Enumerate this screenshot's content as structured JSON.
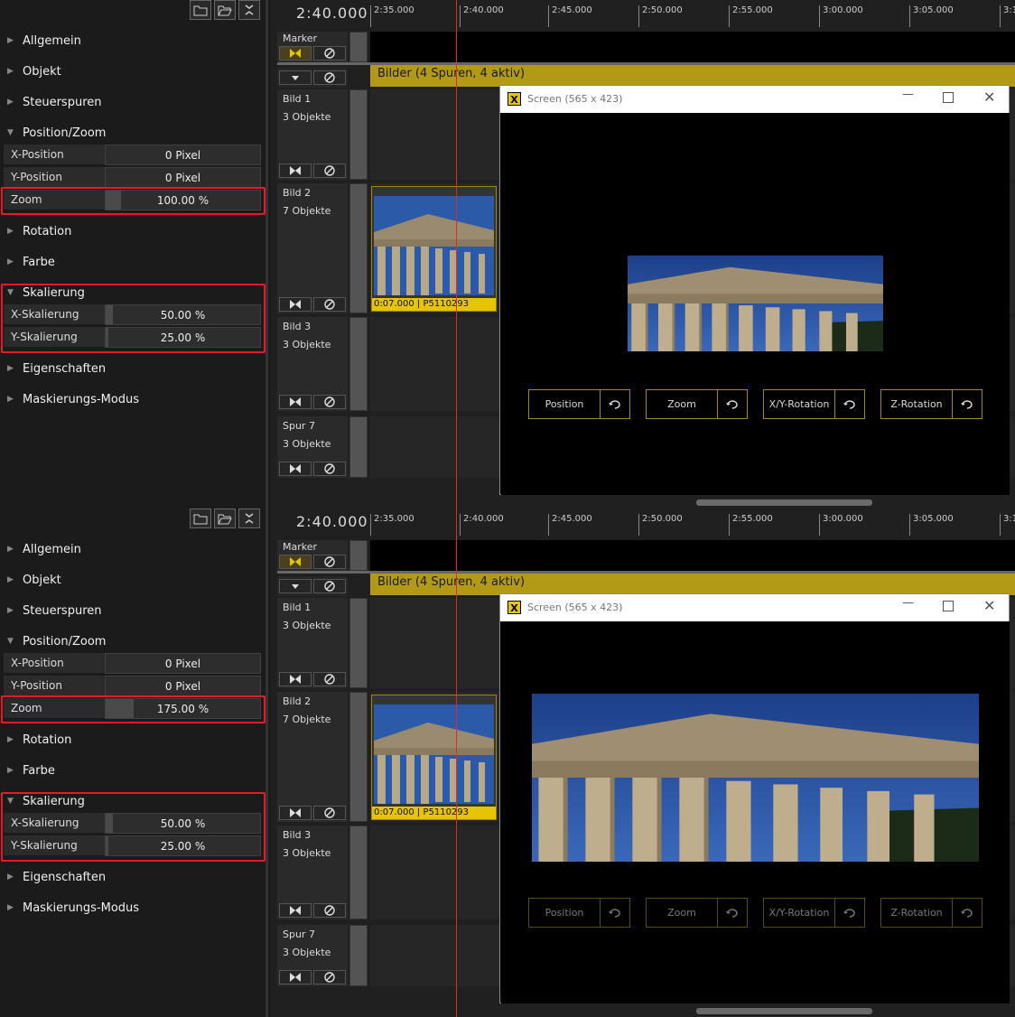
{
  "panels": [
    {
      "sections": {
        "allgemein": "Allgemein",
        "objekt": "Objekt",
        "steuerspuren": "Steuerspuren",
        "position_zoom": "Position/Zoom",
        "rotation": "Rotation",
        "farbe": "Farbe",
        "skalierung": "Skalierung",
        "eigenschaften": "Eigenschaften",
        "maskierung": "Maskierungs-Modus"
      },
      "props": {
        "x_pos_label": "X-Position",
        "x_pos_value": "0 Pixel",
        "y_pos_label": "Y-Position",
        "y_pos_value": "0 Pixel",
        "zoom_label": "Zoom",
        "zoom_value": "100.00 %",
        "zoom_level": 0.1,
        "xs_label": "X-Skalierung",
        "xs_value": "50.00 %",
        "ys_label": "Y-Skalierung",
        "ys_value": "25.00 %"
      },
      "timeline": {
        "time": "2:40.000",
        "ticks": [
          "2:35.000",
          "2:40.000",
          "2:45.000",
          "2:50.000",
          "2:55.000",
          "3:00.000",
          "3:05.000",
          "3:1"
        ],
        "marker": "Marker",
        "group": "Bilder  (4 Spuren, 4 aktiv)",
        "tracks": [
          {
            "name": "Bild 1",
            "objs": "3 Objekte"
          },
          {
            "name": "Bild 2",
            "objs": "7 Objekte"
          },
          {
            "name": "Bild 3",
            "objs": "3 Objekte"
          },
          {
            "name": "Spur 7",
            "objs": "3 Objekte"
          }
        ],
        "clip": "0:07.000  |  P5110293"
      },
      "window": {
        "title": "Screen (565 x 423)",
        "buttons": [
          "Position",
          "Zoom",
          "X/Y-Rotation",
          "Z-Rotation"
        ]
      }
    },
    {
      "sections": {
        "allgemein": "Allgemein",
        "objekt": "Objekt",
        "steuerspuren": "Steuerspuren",
        "position_zoom": "Position/Zoom",
        "rotation": "Rotation",
        "farbe": "Farbe",
        "skalierung": "Skalierung",
        "eigenschaften": "Eigenschaften",
        "maskierung": "Maskierungs-Modus"
      },
      "props": {
        "x_pos_label": "X-Position",
        "x_pos_value": "0 Pixel",
        "y_pos_label": "Y-Position",
        "y_pos_value": "0 Pixel",
        "zoom_label": "Zoom",
        "zoom_value": "175.00 %",
        "zoom_level": 0.18,
        "xs_label": "X-Skalierung",
        "xs_value": "50.00 %",
        "ys_label": "Y-Skalierung",
        "ys_value": "25.00 %"
      },
      "timeline": {
        "time": "2:40.000",
        "ticks": [
          "2:35.000",
          "2:40.000",
          "2:45.000",
          "2:50.000",
          "2:55.000",
          "3:00.000",
          "3:05.000",
          "3:1"
        ],
        "marker": "Marker",
        "group": "Bilder  (4 Spuren, 4 aktiv)",
        "tracks": [
          {
            "name": "Bild 1",
            "objs": "3 Objekte"
          },
          {
            "name": "Bild 2",
            "objs": "7 Objekte"
          },
          {
            "name": "Bild 3",
            "objs": "3 Objekte"
          },
          {
            "name": "Spur 7",
            "objs": "3 Objekte"
          }
        ],
        "clip": "0:07.000  |  P5110293"
      },
      "window": {
        "title": "Screen (565 x 423)",
        "buttons": [
          "Position",
          "Zoom",
          "X/Y-Rotation",
          "Z-Rotation"
        ]
      }
    }
  ],
  "colors": {
    "accent": "#e6c400",
    "highlight": "#e21c2a",
    "playhead": "#e02a2a"
  }
}
